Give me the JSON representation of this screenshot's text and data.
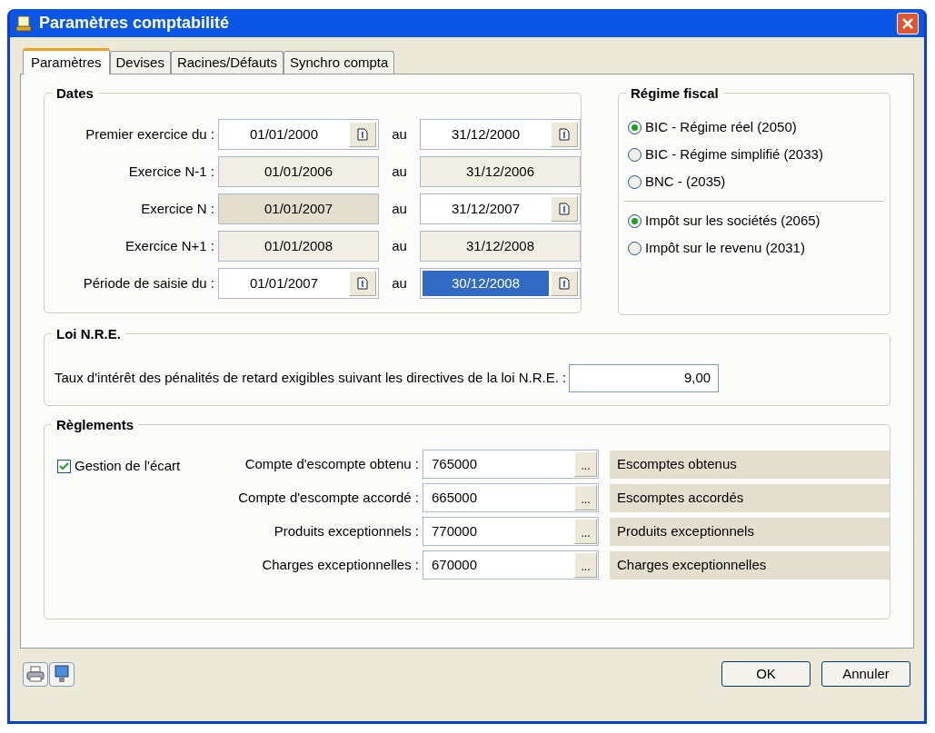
{
  "window": {
    "title": "Paramètres comptabilité"
  },
  "tabs": [
    {
      "label": "Paramètres",
      "selected": true
    },
    {
      "label": "Devises",
      "selected": false
    },
    {
      "label": "Racines/Défauts",
      "selected": false
    },
    {
      "label": "Synchro compta",
      "selected": false
    }
  ],
  "dates": {
    "title": "Dates",
    "rows": [
      {
        "label": "Premier exercice du :",
        "separator": "au",
        "from": {
          "value": "01/01/2000",
          "kind": "input",
          "selected": false
        },
        "to": {
          "value": "31/12/2000",
          "kind": "input",
          "selected": false
        }
      },
      {
        "label": "Exercice N-1 :",
        "separator": "au",
        "from": {
          "value": "01/01/2006",
          "kind": "readonly",
          "selected": false
        },
        "to": {
          "value": "31/12/2006",
          "kind": "readonly",
          "selected": false
        }
      },
      {
        "label": "Exercice N :",
        "separator": "au",
        "from": {
          "value": "01/01/2007",
          "kind": "current",
          "selected": false
        },
        "to": {
          "value": "31/12/2007",
          "kind": "input",
          "selected": false
        }
      },
      {
        "label": "Exercice N+1 :",
        "separator": "au",
        "from": {
          "value": "01/01/2008",
          "kind": "readonly",
          "selected": false
        },
        "to": {
          "value": "31/12/2008",
          "kind": "readonly",
          "selected": false
        }
      },
      {
        "label": "Période de saisie du :",
        "separator": "au",
        "from": {
          "value": "01/01/2007",
          "kind": "input",
          "selected": false
        },
        "to": {
          "value": "30/12/2008",
          "kind": "input",
          "selected": true
        }
      }
    ]
  },
  "regime_fiscal": {
    "title": "Régime fiscal",
    "groups": [
      [
        {
          "label": "BIC - Régime réel (2050)",
          "selected": true
        },
        {
          "label": "BIC - Régime simplifié (2033)",
          "selected": false
        },
        {
          "label": "BNC - (2035)",
          "selected": false
        }
      ],
      [
        {
          "label": "Impôt sur les sociétés (2065)",
          "selected": true
        },
        {
          "label": "Impôt sur le revenu (2031)",
          "selected": false
        }
      ]
    ]
  },
  "loi_nre": {
    "title": "Loi N.R.E.",
    "label": "Taux d'intérêt des pénalités de retard exigibles suivant les directives de la loi N.R.E. :",
    "value": "9,00"
  },
  "reglements": {
    "title": "Règlements",
    "checkbox": {
      "label": "Gestion de l'écart",
      "checked": true
    },
    "browse_label": "...",
    "rows": [
      {
        "label": "Compte d'escompte obtenu :",
        "account": "765000",
        "description": "Escomptes obtenus"
      },
      {
        "label": "Compte d'escompte accordé :",
        "account": "665000",
        "description": "Escomptes accordés"
      },
      {
        "label": "Produits exceptionnels :",
        "account": "770000",
        "description": "Produits exceptionnels"
      },
      {
        "label": "Charges exceptionnelles :",
        "account": "670000",
        "description": "Charges exceptionnelles"
      }
    ]
  },
  "buttons": [
    "OK",
    "Annuler"
  ]
}
